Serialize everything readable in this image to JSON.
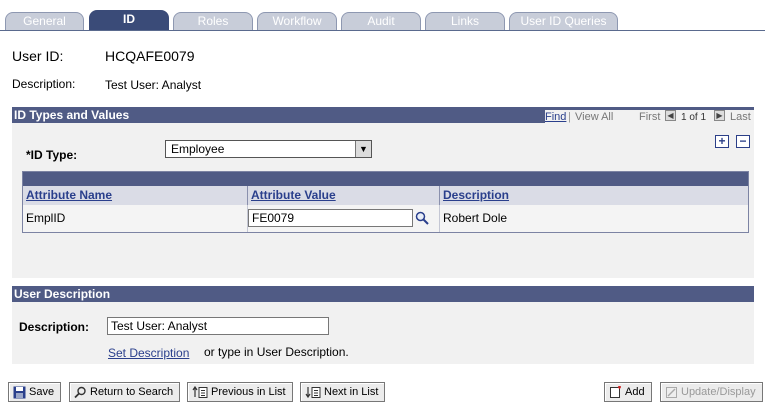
{
  "tabs": [
    {
      "label": "General"
    },
    {
      "label": "ID"
    },
    {
      "label": "Roles"
    },
    {
      "label": "Workflow"
    },
    {
      "label": "Audit"
    },
    {
      "label": "Links"
    },
    {
      "label": "User ID Queries"
    }
  ],
  "header": {
    "user_id_label": "User ID:",
    "user_id_value": "HCQAFE0079",
    "description_label": "Description:",
    "description_value": "Test User: Analyst"
  },
  "id_types": {
    "title": "ID Types and Values",
    "nav": {
      "find": "Find",
      "separator": "|",
      "view_all": "View All",
      "first": "First",
      "position": "1 of 1",
      "last": "Last"
    },
    "id_type_label": "*ID Type:",
    "id_type_value": "Employee",
    "grid": {
      "columns": [
        "Attribute Name",
        "Attribute Value",
        "Description"
      ],
      "rows": [
        {
          "name": "EmplID",
          "value": "FE0079",
          "description": "Robert Dole"
        }
      ]
    }
  },
  "user_description": {
    "title": "User Description",
    "label": "Description:",
    "value": "Test User: Analyst",
    "set_link": "Set Description",
    "hint": "or type in User Description."
  },
  "toolbar": {
    "save": "Save",
    "return": "Return to Search",
    "previous": "Previous in List",
    "next": "Next in List",
    "add": "Add",
    "update": "Update/Display"
  },
  "colors": {
    "section_bar": "#505b85",
    "active_tab": "#3a4b78",
    "link": "#2a3f8c"
  }
}
